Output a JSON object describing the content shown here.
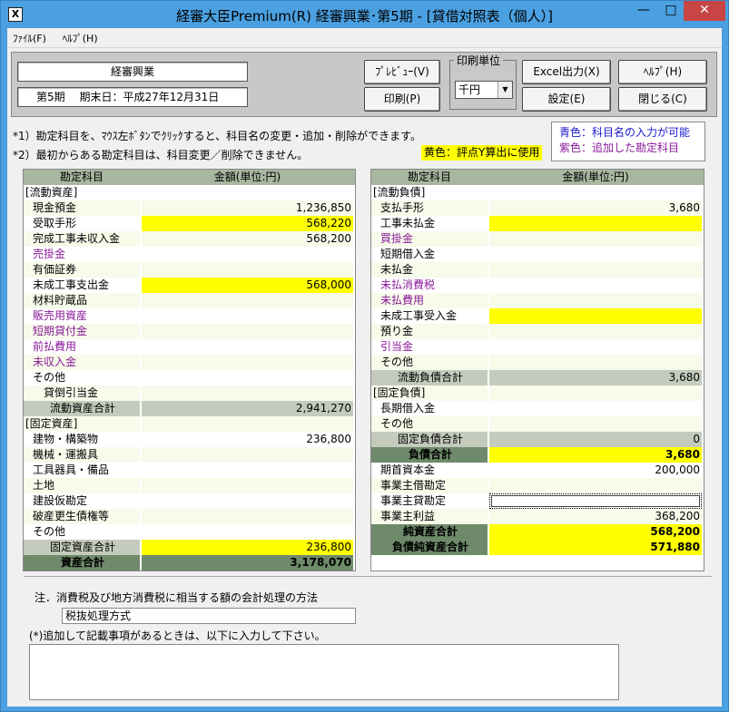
{
  "window": {
    "title": "経審大臣Premium(R)  経審興業･第5期 - [貸借対照表（個人）]",
    "app_icon": "X"
  },
  "menu": [
    {
      "label": "ﾌｧｲﾙ(F)"
    },
    {
      "label": "ﾍﾙﾌﾟ(H)"
    }
  ],
  "header": {
    "company": "経審興業",
    "period": "第5期　 期末日：平成27年12月31日",
    "print_unit_label": "印刷単位",
    "print_unit_value": "千円",
    "buttons": {
      "preview": "ﾌﾟﾚﾋﾞｭｰ(V)",
      "print": "印刷(P)",
      "excel": "Excel出力(X)",
      "settings": "設定(E)",
      "help": "ﾍﾙﾌﾟ(H)",
      "close": "閉じる(C)"
    }
  },
  "notes": {
    "n1": "*1）勘定科目を、ﾏｳｽ左ﾎﾞﾀﾝでｸﾘｯｸすると、科目名の変更・追加・削除ができます。",
    "n2": "*2）最初からある勘定科目は、科目変更／削除できません。",
    "yellow_legend": "黄色：評点Y算出に使用",
    "blue_legend": "青色：科目名の入力が可能",
    "purple_legend": "紫色：追加した勘定科目"
  },
  "colors": {
    "yellow": "#ffff00",
    "purple": "#8a1a9a",
    "blue": "#1a1ad0",
    "header_green": "#a8b8a0",
    "total_green": "#6e8a6a"
  },
  "left_table": {
    "col_account": "勘定科目",
    "col_amount": "金額(単位:円)",
    "rows": [
      {
        "name": "[流動資産]",
        "amount": "",
        "style": "section"
      },
      {
        "name": "現金預金",
        "amount": "1,236,850",
        "style": "normal"
      },
      {
        "name": "受取手形",
        "amount": "568,220",
        "style": "yellow"
      },
      {
        "name": "完成工事未収入金",
        "amount": "568,200",
        "style": "yellow"
      },
      {
        "name": "売掛金",
        "amount": "",
        "style": "purple"
      },
      {
        "name": "有価証券",
        "amount": "",
        "style": "normal"
      },
      {
        "name": "未成工事支出金",
        "amount": "568,000",
        "style": "yellow"
      },
      {
        "name": "材料貯蔵品",
        "amount": "",
        "style": "yellow"
      },
      {
        "name": "販売用資産",
        "amount": "",
        "style": "purple"
      },
      {
        "name": "短期貸付金",
        "amount": "",
        "style": "purple"
      },
      {
        "name": "前払費用",
        "amount": "",
        "style": "purple"
      },
      {
        "name": "未収入金",
        "amount": "",
        "style": "purple"
      },
      {
        "name": "その他",
        "amount": "",
        "style": "normal"
      },
      {
        "name": "　貸倒引当金",
        "amount": "",
        "style": "yellow"
      },
      {
        "name": "流動資産合計",
        "amount": "2,941,270",
        "style": "subtotal"
      },
      {
        "name": "[固定資産]",
        "amount": "",
        "style": "section"
      },
      {
        "name": "建物・構築物",
        "amount": "236,800",
        "style": "normal"
      },
      {
        "name": "機械・運搬具",
        "amount": "",
        "style": "normal"
      },
      {
        "name": "工具器具・備品",
        "amount": "",
        "style": "normal"
      },
      {
        "name": "土地",
        "amount": "",
        "style": "normal"
      },
      {
        "name": "建設仮勘定",
        "amount": "",
        "style": "normal"
      },
      {
        "name": "破産更生債権等",
        "amount": "",
        "style": "normal"
      },
      {
        "name": "その他",
        "amount": "",
        "style": "normal"
      },
      {
        "name": "固定資産合計",
        "amount": "236,800",
        "style": "subtotal-yellow"
      },
      {
        "name": "資産合計",
        "amount": "3,178,070",
        "style": "total"
      }
    ]
  },
  "right_table": {
    "col_account": "勘定科目",
    "col_amount": "金額(単位:円)",
    "rows": [
      {
        "name": "[流動負債]",
        "amount": "",
        "style": "section"
      },
      {
        "name": "支払手形",
        "amount": "3,680",
        "style": "yellow"
      },
      {
        "name": "工事未払金",
        "amount": "",
        "style": "yellow"
      },
      {
        "name": "買掛金",
        "amount": "",
        "style": "purple"
      },
      {
        "name": "短期借入金",
        "amount": "",
        "style": "normal"
      },
      {
        "name": "未払金",
        "amount": "",
        "style": "normal"
      },
      {
        "name": "未払消費税",
        "amount": "",
        "style": "purple"
      },
      {
        "name": "未払費用",
        "amount": "",
        "style": "purple"
      },
      {
        "name": "未成工事受入金",
        "amount": "",
        "style": "yellow"
      },
      {
        "name": "預り金",
        "amount": "",
        "style": "normal"
      },
      {
        "name": "引当金",
        "amount": "",
        "style": "purple"
      },
      {
        "name": "その他",
        "amount": "",
        "style": "normal"
      },
      {
        "name": "流動負債合計",
        "amount": "3,680",
        "style": "subtotal"
      },
      {
        "name": "[固定負債]",
        "amount": "",
        "style": "section"
      },
      {
        "name": "長期借入金",
        "amount": "",
        "style": "normal"
      },
      {
        "name": "その他",
        "amount": "",
        "style": "normal"
      },
      {
        "name": "固定負債合計",
        "amount": "0",
        "style": "subtotal"
      },
      {
        "name": "負債合計",
        "amount": "3,680",
        "style": "total-yellow"
      },
      {
        "name": "期首資本金",
        "amount": "200,000",
        "style": "normal"
      },
      {
        "name": "事業主借勘定",
        "amount": "",
        "style": "normal"
      },
      {
        "name": "事業主貸勘定",
        "amount": "",
        "style": "selected"
      },
      {
        "name": "事業主利益",
        "amount": "368,200",
        "style": "yellow"
      },
      {
        "name": "純資産合計",
        "amount": "568,200",
        "style": "total-yellow"
      },
      {
        "name": "負債純資産合計",
        "amount": "571,880",
        "style": "total-yellow"
      }
    ]
  },
  "bottom": {
    "heading": "注．消費税及び地方消費税に相当する額の会計処理の方法",
    "tax_method": "税抜処理方式",
    "memo_label": "(*)追加して記載事項があるときは、以下に入力して下さい。",
    "memo_value": ""
  }
}
